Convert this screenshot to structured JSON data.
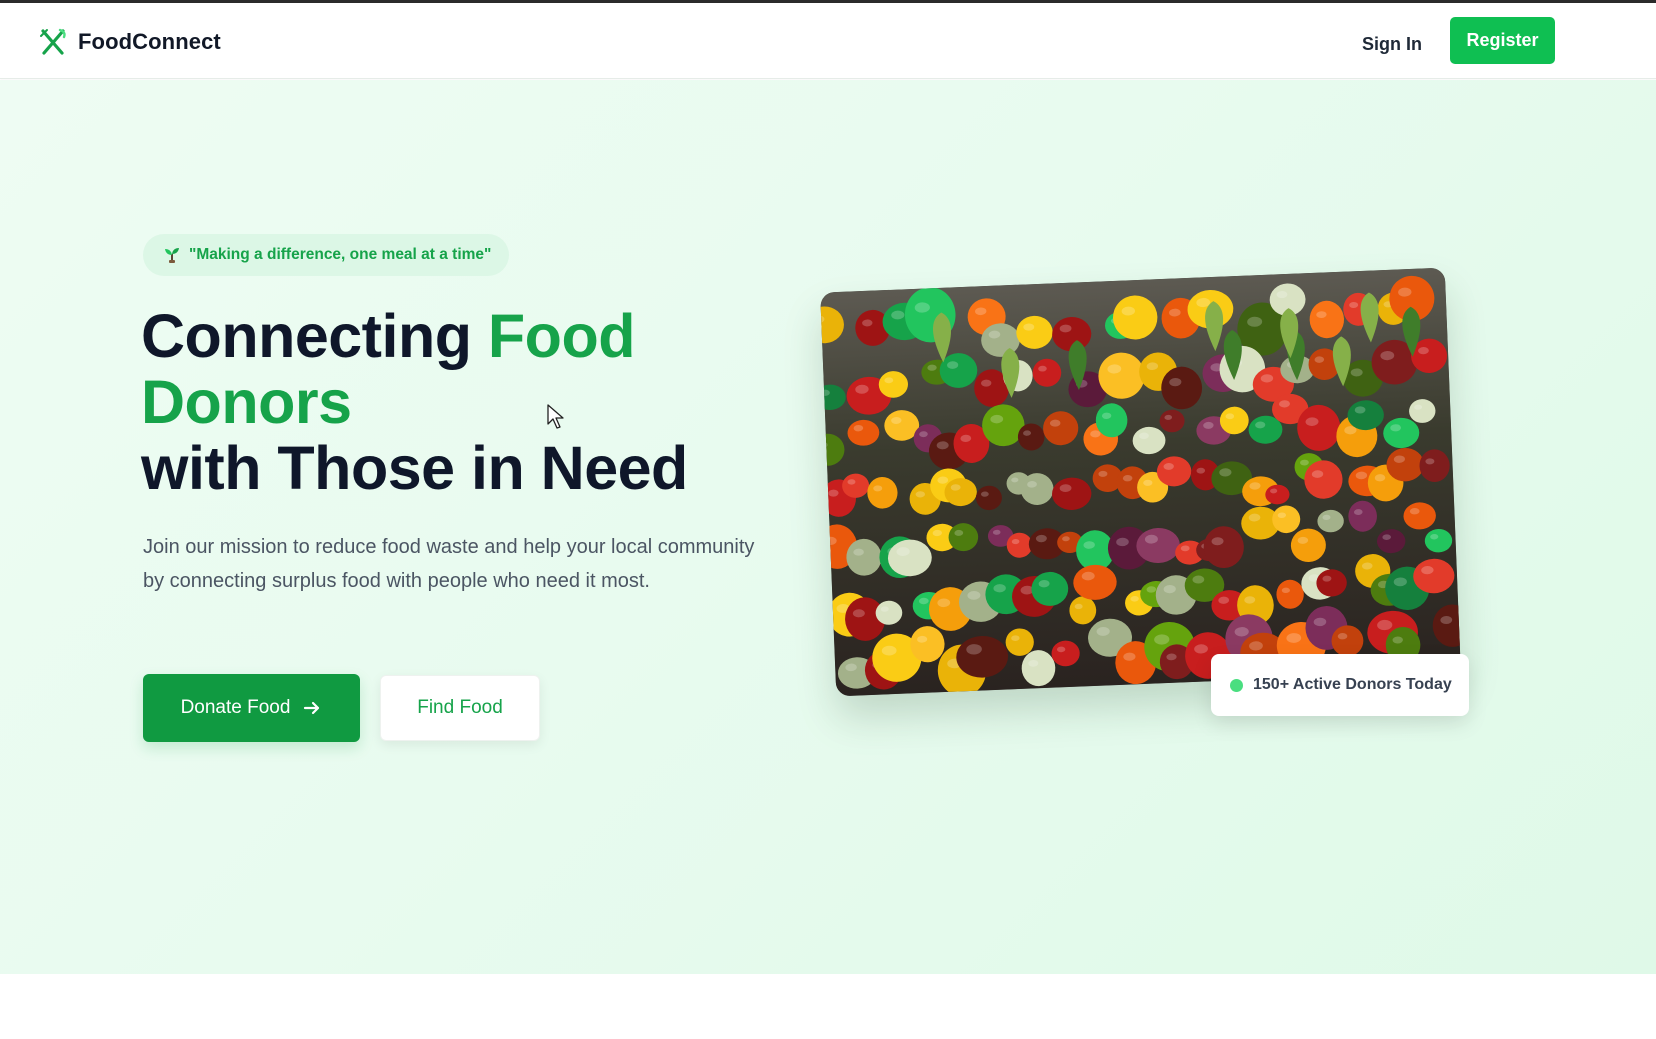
{
  "navbar": {
    "brand": "FoodConnect",
    "brand_icon": "utensils-icon",
    "sign_in": "Sign In",
    "register": "Register"
  },
  "hero": {
    "tagline_icon": "sprout-icon",
    "tagline": "\"Making a difference, one meal at a time\"",
    "headline_part1": "Connecting ",
    "headline_highlight": "Food Donors",
    "headline_part2": "with Those in Need",
    "description": "Join our mission to reduce food waste and help your local community by connecting surplus food with people who need it most.",
    "donate_button": "Donate Food",
    "donate_icon": "arrow-right-icon",
    "find_button": "Find Food",
    "image_subject": "fresh-produce-market-photo",
    "badge_text": "150+ Active Donors Today"
  },
  "colors": {
    "brand_green": "#16a34a",
    "button_green": "#109a41",
    "register_green": "#0fbf52",
    "hero_background": "#e8fbef",
    "heading_dark": "#0f172a",
    "status_dot": "#4ade80"
  }
}
